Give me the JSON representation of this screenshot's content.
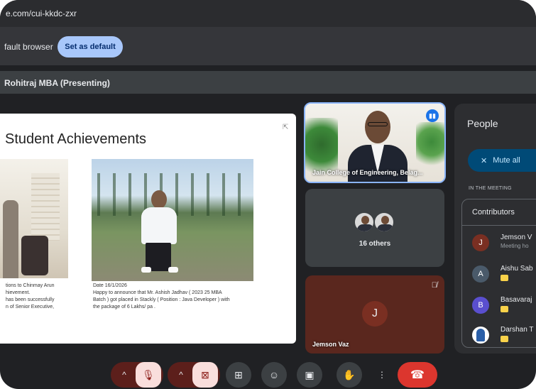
{
  "browser": {
    "url": "e.com/cui-kkdc-zxr",
    "infobar_message": "fault browser",
    "set_default_label": "Set as default"
  },
  "presenting_label": "Rohitraj MBA (Presenting)",
  "slide": {
    "title": "Student Achievements",
    "caption_left": [
      "tions to Chinmay Arun",
      "hievement.",
      "has been successfully",
      "n of Senior Executive,"
    ],
    "caption_right": [
      "Date 16/1/2026",
      "Happy to announce that Mr. Ashish Jadhav ( 2023 25 MBA",
      "Batch ) got placed in Stackly ( Position : Java Developer ) with",
      "the package of 6 Lakhs/ pa ."
    ]
  },
  "tiles": {
    "speaker_name": "Jain College of Engineering, Belag...",
    "others_label": "16 others",
    "jemson_initial": "J",
    "jemson_name": "Jemson Vaz"
  },
  "people_panel": {
    "title": "People",
    "mute_all_label": "Mute all",
    "in_meeting_label": "IN THE MEETING",
    "contributors_label": "Contributors",
    "participants": [
      {
        "initial": "J",
        "name": "Jemson V",
        "sub": "Meeting ho",
        "color": "#7a2f22"
      },
      {
        "initial": "A",
        "name": "Aishu Sab",
        "sub": "",
        "color": "#4a5a6a"
      },
      {
        "initial": "B",
        "name": "Basavaraj",
        "sub": "",
        "color": "#5a4fcf"
      },
      {
        "initial": "",
        "name": "Darshan T",
        "sub": "",
        "color": "#8ab4f8"
      }
    ]
  },
  "controls": {
    "chevron": "^",
    "mic_icon": "mic-off-icon",
    "cam_icon": "camera-off-icon",
    "present_icon": "present-icon",
    "emoji_icon": "emoji-icon",
    "captions_icon": "captions-icon",
    "raise_hand_icon": "raise-hand-icon",
    "more_icon": "more-vert-icon",
    "end_call_icon": "end-call-icon"
  },
  "colors": {
    "accent": "#8ab4f8",
    "end_call": "#dc362e",
    "muted_bg": "#f9dedc"
  }
}
